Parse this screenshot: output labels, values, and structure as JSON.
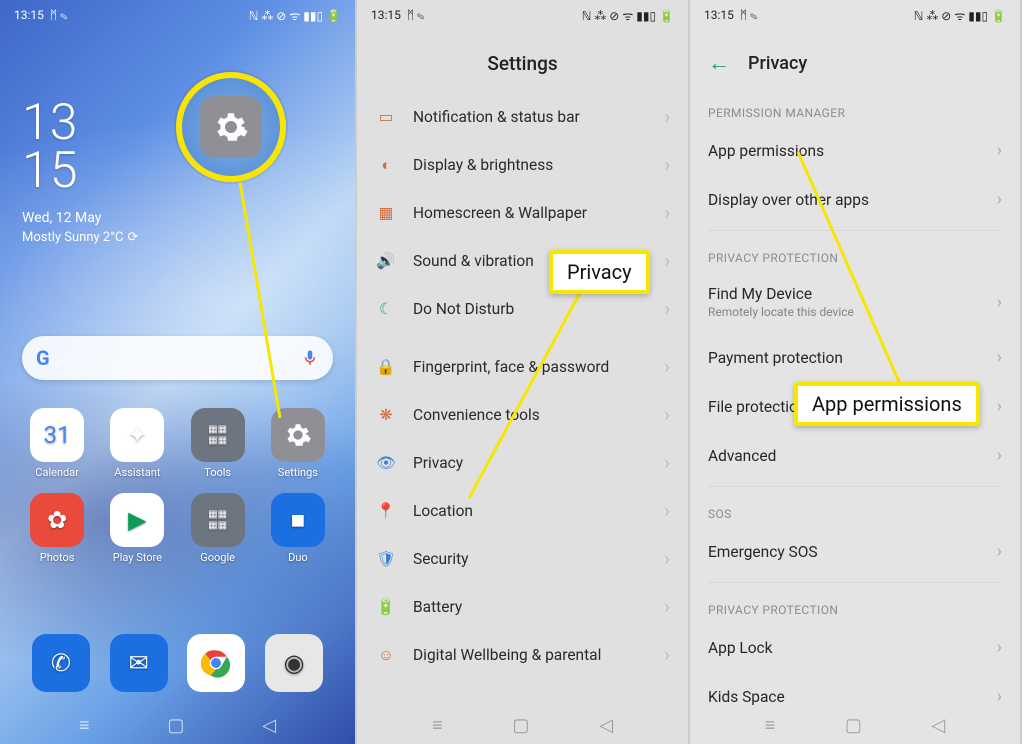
{
  "status": {
    "time_short": "13:15",
    "icons_left": "ᛗ ✎",
    "icons_right": "ℕ ⁂ ⊘ ᯤ ▮▮▯ 🔋"
  },
  "home": {
    "clock_line1": "13",
    "clock_line2": "15",
    "date": "Wed, 12 May",
    "weather": "Mostly Sunny 2°C",
    "apps_row": [
      {
        "label": "Calendar",
        "bg": "#fff"
      },
      {
        "label": "Assistant",
        "bg": "#fff"
      },
      {
        "label": "Tools",
        "bg": "#6d7580"
      },
      {
        "label": "Settings",
        "bg": "#8f8f95"
      }
    ],
    "apps_row2": [
      {
        "label": "Photos",
        "bg": "#e84b3c"
      },
      {
        "label": "Play Store",
        "bg": "#fff"
      },
      {
        "label": "Google",
        "bg": "#6d7580"
      },
      {
        "label": "Duo",
        "bg": "#1b6fe0"
      }
    ],
    "dock": [
      {
        "label": "Phone",
        "bg": "#1b6fe0"
      },
      {
        "label": "Messages",
        "bg": "#1b6fe0"
      },
      {
        "label": "Chrome",
        "bg": "#fff"
      },
      {
        "label": "Camera",
        "bg": "#e7e7e7"
      }
    ]
  },
  "settings": {
    "title": "Settings",
    "items": [
      "Notification & status bar",
      "Display & brightness",
      "Homescreen & Wallpaper",
      "Sound & vibration",
      "Do Not Disturb",
      "Fingerprint, face & password",
      "Convenience tools",
      "Privacy",
      "Location",
      "Security",
      "Battery",
      "Digital Wellbeing & parental"
    ],
    "callout": "Privacy"
  },
  "privacy": {
    "title": "Privacy",
    "sect1": "PERMISSION MANAGER",
    "sect1_items": [
      "App permissions",
      "Display over other apps"
    ],
    "sect2": "PRIVACY PROTECTION",
    "sect2_items": [
      {
        "label": "Find My Device",
        "sub": "Remotely locate this device"
      },
      {
        "label": "Payment protection"
      },
      {
        "label": "File protection"
      },
      {
        "label": "Advanced"
      }
    ],
    "sect3": "SOS",
    "sect3_items": [
      "Emergency SOS"
    ],
    "sect4": "PRIVACY PROTECTION",
    "sect4_items": [
      "App Lock",
      "Kids Space"
    ],
    "callout": "App permissions"
  }
}
